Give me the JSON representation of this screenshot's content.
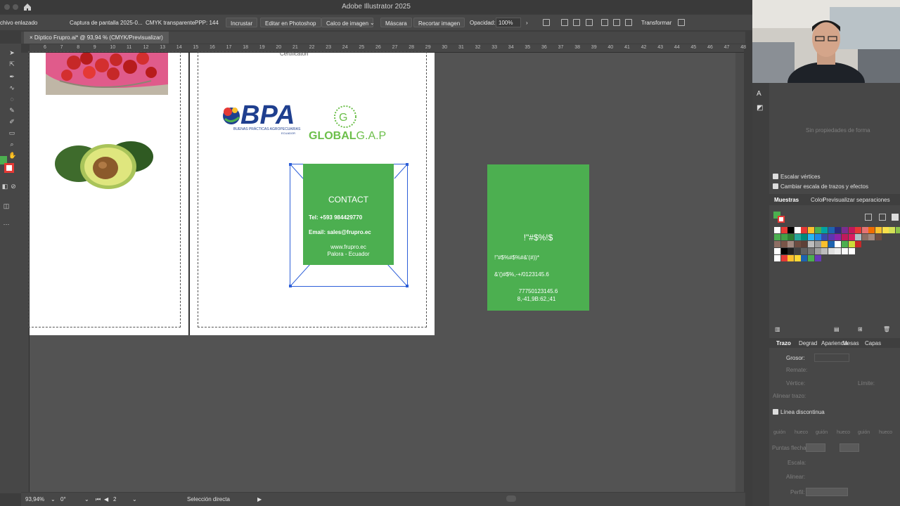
{
  "window": {
    "title": "Adobe Illustrator 2025"
  },
  "control_bar": {
    "link_state": "chivo enlazado",
    "file_name": "Captura de pantalla 2025-0...",
    "color_mode": "CMYK transparente",
    "ppp": "PPP: 144",
    "embed_label": "Incrustar",
    "edit_photoshop_label": "Editar en Photoshop",
    "trace_label": "Calco de imagen",
    "mask_label": "Máscara",
    "crop_label": "Recortar imagen",
    "opacity_label": "Opacidad:",
    "opacity_value": "100%",
    "transform_label": "Transformar"
  },
  "document_tab": {
    "label": "Díptico Frupro.ai* @ 93,94 % (CMYK/Previsualizar)"
  },
  "ruler": {
    "ticks": [
      "6",
      "7",
      "8",
      "9",
      "10",
      "11",
      "12",
      "13",
      "14",
      "15",
      "16",
      "17",
      "18",
      "19",
      "20",
      "21",
      "22",
      "23",
      "24",
      "25",
      "26",
      "27",
      "28",
      "29",
      "30",
      "31",
      "32",
      "33",
      "34",
      "35",
      "36",
      "37",
      "38",
      "39",
      "40",
      "41",
      "42",
      "43",
      "44",
      "45",
      "46",
      "47",
      "48"
    ]
  },
  "artboard_right": {
    "cert_text": "Certificaton",
    "bpa": {
      "name": "BPA",
      "subtitle": "BUENAS PRÁCTICAS AGROPECUARIAS",
      "country": "ECUADOR"
    },
    "globalgap": {
      "prefix": "GLOBAL",
      "suffix": "G.A.P"
    },
    "contact_card": {
      "title": "CONTACT",
      "tel": "Tel: +593 984429770",
      "email": "Email: sales@frupro.ec",
      "web": "www.frupro.ec",
      "location": "Palora - Ecuador"
    }
  },
  "outlined_card": {
    "title": "!\"#$%!$",
    "line1": "!\"#$%#$%#&'(#))*",
    "line2": "&'()#$%,-+/0123145.6",
    "line3": "77750123145.6",
    "line4": "8,-41,9B:62,;41"
  },
  "status_bar": {
    "zoom": "93,94%",
    "angle": "0°",
    "page": "2",
    "tool": "Selección directa"
  },
  "right_panel": {
    "no_shape_props": "Sin propiedades de forma",
    "scale_corners": "Escalar vértices",
    "scale_strokes": "Cambiar escala de trazos y efectos",
    "swatch_tabs": [
      "Muestras",
      "Color",
      "Previsualizar separaciones"
    ],
    "stroke_tabs": [
      "Trazo",
      "Degrad",
      "Apariencia",
      "Mesas",
      "Capas"
    ],
    "weight_label": "Grosor:",
    "cap_label": "Remate:",
    "corner_label": "Vértice:",
    "limit_label": "Límite:",
    "align_label": "Alinear trazo:",
    "dashed_label": "Línea discontinua",
    "dash_cols": [
      "guión",
      "hueco",
      "guión",
      "hueco",
      "guión",
      "hueco"
    ],
    "arrow_label": "Puntas flecha:",
    "scale_label": "Escala:",
    "align2_label": "Alinear:",
    "profile_label": "Perfil:"
  },
  "colors": {
    "green": "#4caf50",
    "canvas": "#535353",
    "panel": "#474747",
    "selection": "#2d5fd8"
  }
}
